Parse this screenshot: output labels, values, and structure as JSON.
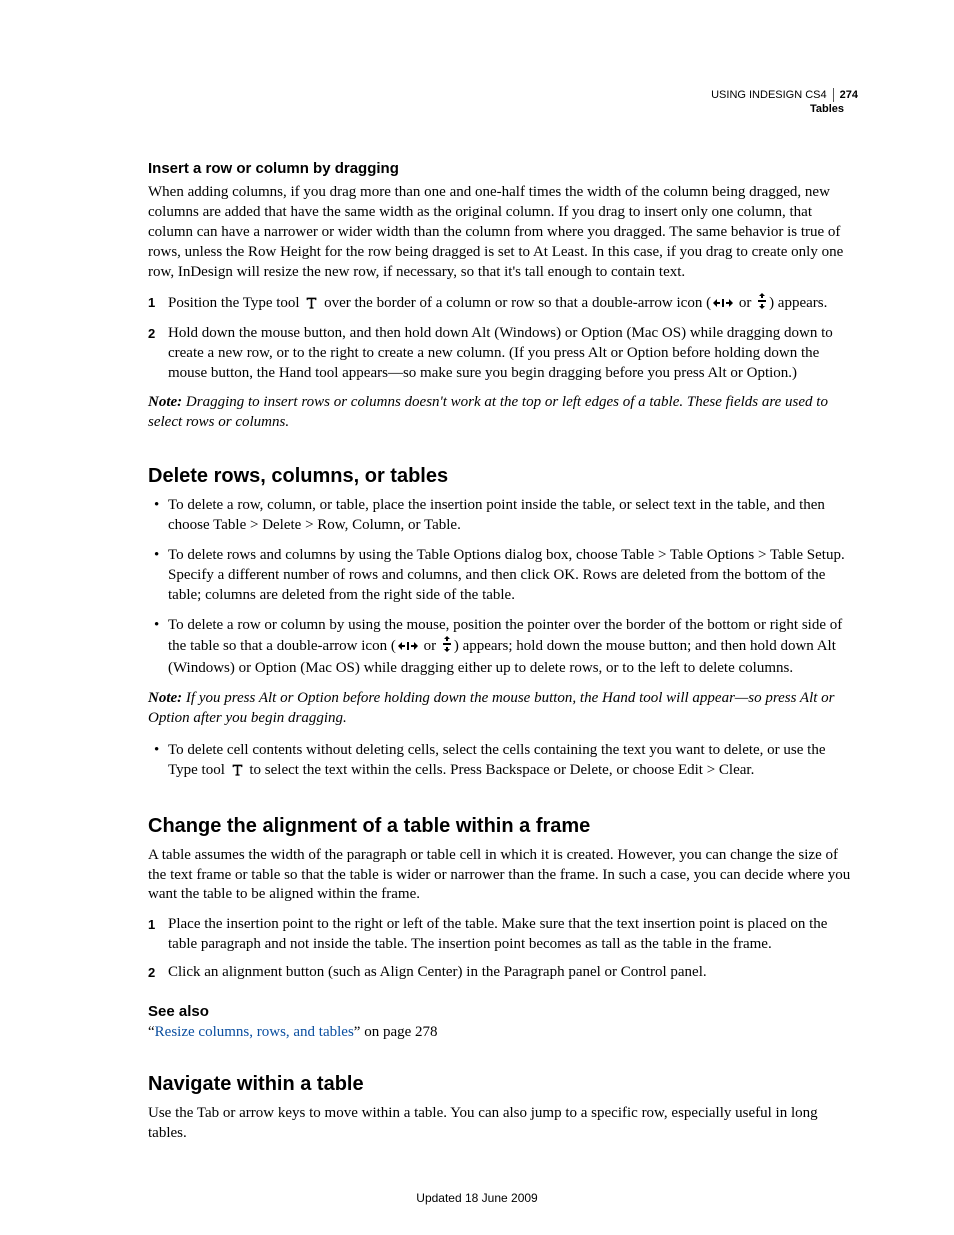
{
  "header": {
    "doc_title": "USING INDESIGN CS4",
    "page_num": "274",
    "section": "Tables"
  },
  "s1": {
    "h": "Insert a row or column by dragging",
    "p": "When adding columns, if you drag more than one and one-half times the width of the column being dragged, new columns are added that have the same width as the original column. If you drag to insert only one column, that column can have a narrower or wider width than the column from where you dragged. The same behavior is true of rows, unless the Row Height for the row being dragged is set to At Least. In this case, if you drag to create only one row, InDesign will resize the new row, if necessary, so that it's tall enough to contain text.",
    "step1_a": "Position the Type tool ",
    "step1_b": " over the border of a column or row so that a double-arrow icon (",
    "step1_c": " or ",
    "step1_d": ") appears.",
    "step2": "Hold down the mouse button, and then hold down Alt (Windows) or Option (Mac OS) while dragging down to create a new row, or to the right to create a new column. (If you press Alt or Option before holding down the mouse button, the Hand tool appears—so make sure you begin dragging before you press Alt or Option.)",
    "note_label": "Note: ",
    "note": "Dragging to insert rows or columns doesn't work at the top or left edges of a table. These fields are used to select rows or columns."
  },
  "s2": {
    "h": "Delete rows, columns, or tables",
    "b1": "To delete a row, column, or table, place the insertion point inside the table, or select text in the table, and then choose Table > Delete > Row, Column, or Table.",
    "b2": "To delete rows and columns by using the Table Options dialog box, choose Table > Table Options > Table Setup. Specify a different number of rows and columns, and then click OK. Rows are deleted from the bottom of the table; columns are deleted from the right side of the table.",
    "b3_a": "To delete a row or column by using the mouse, position the pointer over the border of the bottom or right side of the table so that a double-arrow icon (",
    "b3_b": " or ",
    "b3_c": ") appears; hold down the mouse button; and then hold down Alt (Windows) or Option (Mac OS) while dragging either up to delete rows, or to the left to delete columns.",
    "note_label": "Note: ",
    "note": "If you press Alt or Option before holding down the mouse button, the Hand tool will appear—so press Alt or Option after you begin dragging.",
    "b4_a": "To delete cell contents without deleting cells, select the cells containing the text you want to delete, or use the Type tool ",
    "b4_b": " to select the text within the cells. Press Backspace or Delete, or choose Edit > Clear."
  },
  "s3": {
    "h": "Change the alignment of a table within a frame",
    "p": "A table assumes the width of the paragraph or table cell in which it is created. However, you can change the size of the text frame or table so that the table is wider or narrower than the frame. In such a case, you can decide where you want the table to be aligned within the frame.",
    "step1": "Place the insertion point to the right or left of the table. Make sure that the text insertion point is placed on the table paragraph and not inside the table. The insertion point becomes as tall as the table in the frame.",
    "step2": "Click an alignment button (such as Align Center) in the Paragraph panel or Control panel."
  },
  "seealso": {
    "h": "See also",
    "q1": "“",
    "link": "Resize columns, rows, and tables",
    "q2": "” on page 278"
  },
  "s4": {
    "h": "Navigate within a table",
    "p": "Use the Tab or arrow keys to move within a table. You can also jump to a specific row, especially useful in long tables."
  },
  "footer": "Updated 18 June 2009"
}
